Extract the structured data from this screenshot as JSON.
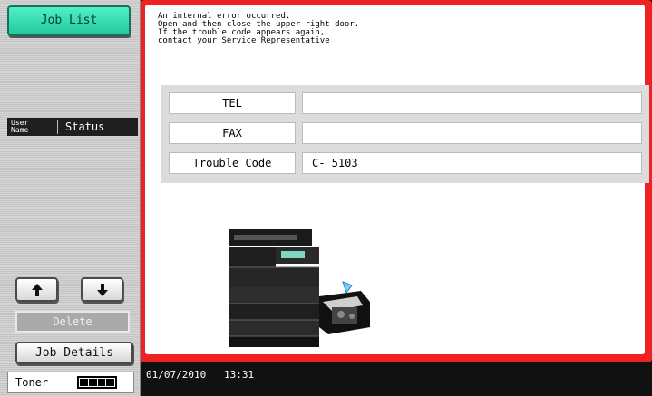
{
  "sidebar": {
    "job_list_label": "Job List",
    "columns": {
      "user_name": "User\nName",
      "status": "Status"
    },
    "delete_label": "Delete",
    "job_details_label": "Job Details",
    "toner_label": "Toner",
    "toner_level": 1.0
  },
  "error": {
    "message": "An internal error occurred.\nOpen and then close the upper right door.\nIf the trouble code appears again,\ncontact your Service Representative",
    "fields": {
      "tel_label": "TEL",
      "tel_value": "",
      "fax_label": "FAX",
      "fax_value": "",
      "code_label": "Trouble Code",
      "code_value": "C- 5103"
    }
  },
  "status_bar": {
    "date": "01/07/2010",
    "time": "13:31"
  },
  "colors": {
    "accent": "#2ddcaf",
    "error_border": "#ee2222"
  }
}
